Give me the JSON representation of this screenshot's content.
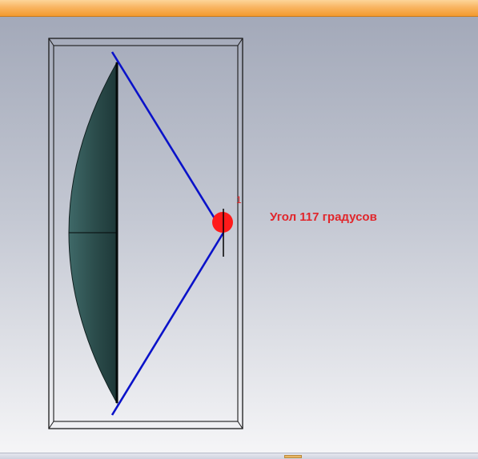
{
  "annotation": {
    "angle_text": "Угол 117 градусов",
    "angle_degrees": 117,
    "marker_number": "1"
  },
  "colors": {
    "ray": "#0a12c9",
    "lens": "#2c4f4e",
    "marker": "#ff1a1a",
    "annotation_text": "#e1262b"
  }
}
